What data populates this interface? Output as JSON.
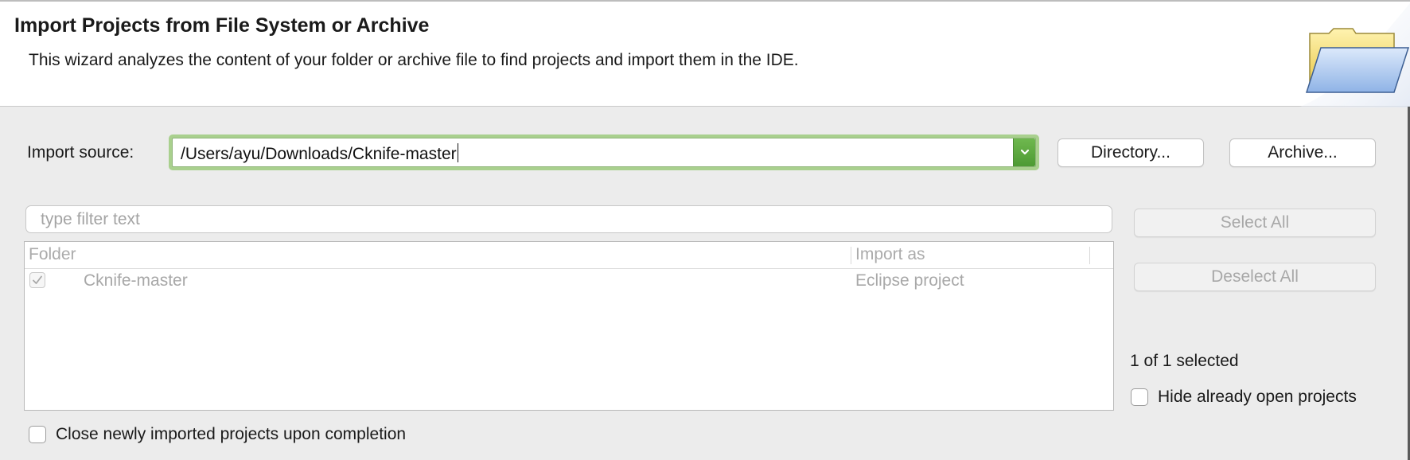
{
  "header": {
    "title": "Import Projects from File System or Archive",
    "description": "This wizard analyzes the content of your folder or archive file to find projects and import them in the IDE.",
    "icon": "folder-icon"
  },
  "source": {
    "label": "Import source:",
    "value": "/Users/ayu/Downloads/Cknife-master",
    "directory_label": "Directory...",
    "archive_label": "Archive..."
  },
  "filter": {
    "placeholder": "type filter text",
    "value": ""
  },
  "table": {
    "columns": [
      "Folder",
      "Import as"
    ],
    "rows": [
      {
        "checked": true,
        "folder": "Cknife-master",
        "import_as": "Eclipse project"
      }
    ]
  },
  "actions": {
    "select_all": "Select All",
    "deselect_all": "Deselect All"
  },
  "status": {
    "selected_text": "1 of 1 selected"
  },
  "options": {
    "hide_open_label": "Hide already open projects",
    "hide_open_checked": false,
    "close_after_label": "Close newly imported projects upon completion",
    "close_after_checked": false
  },
  "colors": {
    "focus_ring": "#a9d08e",
    "dropdown_accent": "#5aa63d",
    "disabled_text": "#a8a8a8"
  }
}
